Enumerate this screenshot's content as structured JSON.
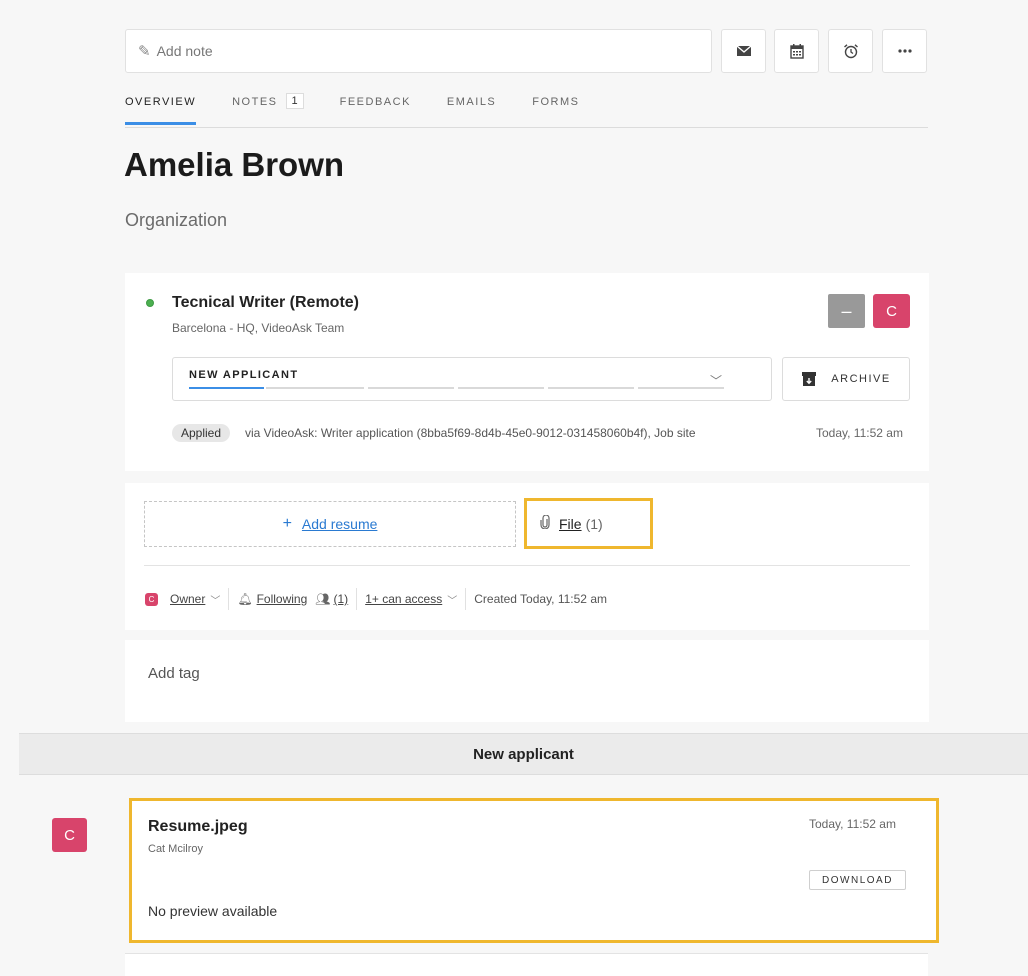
{
  "note": {
    "placeholder": "Add note"
  },
  "toolbar": {
    "email_icon": "envelope-icon",
    "calendar_icon": "calendar-icon",
    "reminder_icon": "alarm-clock-icon",
    "more_icon": "more-dots-icon"
  },
  "tabs": [
    {
      "label": "OVERVIEW",
      "active": true
    },
    {
      "label": "NOTES",
      "count": "1"
    },
    {
      "label": "FEEDBACK"
    },
    {
      "label": "EMAILS"
    },
    {
      "label": "FORMS"
    }
  ],
  "candidate": {
    "name": "Amelia Brown",
    "organization": "Organization"
  },
  "job": {
    "title": "Tecnical Writer (Remote)",
    "subtitle": "Barcelona - HQ, VideoAsk Team",
    "minus_label": "–",
    "avatar_letter": "C",
    "stage": "NEW APPLICANT",
    "archive_label": "ARCHIVE",
    "applied_badge": "Applied",
    "applied_source": "via VideoAsk: Writer application (8bba5f69-8d4b-45e0-9012-031458060b4f), Job site",
    "applied_time": "Today, 11:52 am"
  },
  "resume": {
    "add_plus": "+",
    "add_label": "Add resume",
    "file_label": "File",
    "file_count": "(1)"
  },
  "meta": {
    "avatar_letter": "C",
    "owner_label": "Owner",
    "following_label": "Following",
    "followers_count": "(1)",
    "access_label": "1+ can access",
    "created_label": "Created Today, 11:52 am"
  },
  "tags": {
    "add_label": "Add tag"
  },
  "stage_band": {
    "title": "New applicant"
  },
  "file_entry": {
    "avatar_letter": "C",
    "name": "Resume.jpeg",
    "owner": "Cat Mcilroy",
    "time": "Today, 11:52 am",
    "download_label": "DOWNLOAD",
    "preview_text": "No preview available"
  },
  "colors": {
    "accent": "#3b8ee6",
    "highlight": "#efb72e",
    "avatar": "#d8446b",
    "status": "#4caf50"
  }
}
